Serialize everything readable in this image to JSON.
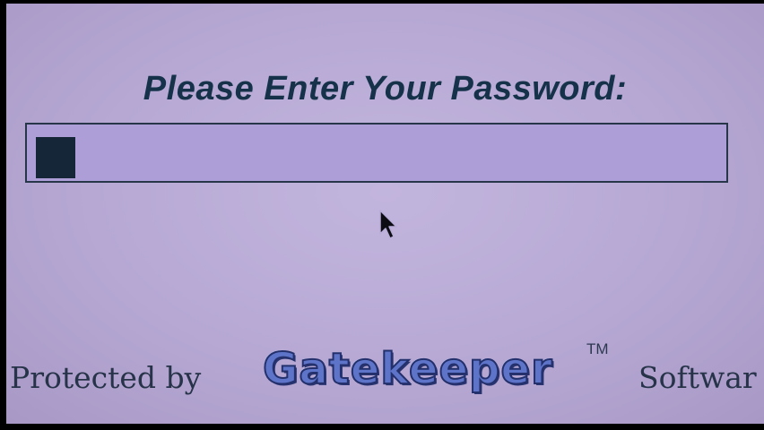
{
  "prompt": {
    "title": "Please Enter Your Password:"
  },
  "password_field": {
    "value": "",
    "cursor": "block-cursor"
  },
  "footer": {
    "protected_by": "Protected by",
    "brand": "Gatekeeper",
    "trademark": "TM",
    "suffix": "Softwar"
  },
  "colors": {
    "screen_background": "#b6a8d3",
    "field_background": "#ad9ed8",
    "text_dark": "#16324a",
    "brand_blue": "#5e74c8"
  },
  "icons": {
    "pointer": "mouse-pointer-icon"
  }
}
